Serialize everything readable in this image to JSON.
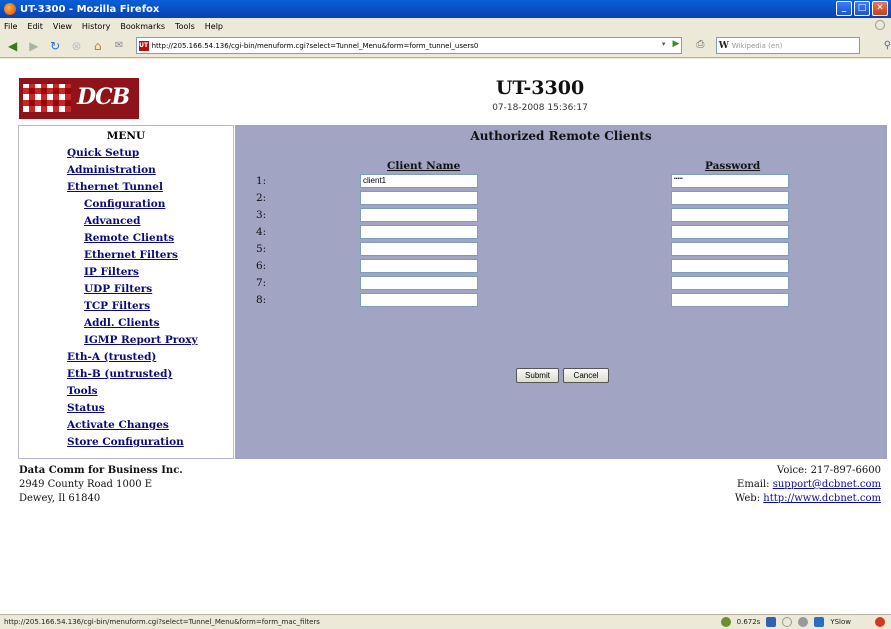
{
  "window": {
    "title": "UT-3300 - Mozilla Firefox"
  },
  "menubar": [
    "File",
    "Edit",
    "View",
    "History",
    "Bookmarks",
    "Tools",
    "Help"
  ],
  "browser": {
    "url": "http://205.166.54.136/cgi-bin/menuform.cgi?select=Tunnel_Menu&form=form_tunnel_users0",
    "search_placeholder": "Wikipedia (en)",
    "search_engine": "W"
  },
  "header": {
    "logo_text": "DCB",
    "device": "UT-3300",
    "datetime": "07-18-2008 15:36:17"
  },
  "menu": {
    "title": "MENU",
    "items": [
      {
        "label": "Quick Setup",
        "level": 1
      },
      {
        "label": "Administration",
        "level": 1
      },
      {
        "label": "Ethernet Tunnel",
        "level": 1
      },
      {
        "label": "Configuration",
        "level": 2
      },
      {
        "label": "Advanced",
        "level": 2
      },
      {
        "label": "Remote Clients",
        "level": 2
      },
      {
        "label": "Ethernet Filters",
        "level": 2
      },
      {
        "label": "IP Filters",
        "level": 2
      },
      {
        "label": "UDP Filters",
        "level": 2
      },
      {
        "label": "TCP Filters",
        "level": 2
      },
      {
        "label": "Addl. Clients",
        "level": 2
      },
      {
        "label": "IGMP Report Proxy",
        "level": 2
      },
      {
        "label": "Eth-A (trusted)",
        "level": 1
      },
      {
        "label": "Eth-B (untrusted)",
        "level": 1
      },
      {
        "label": "Tools",
        "level": 1
      },
      {
        "label": "Status",
        "level": 1
      },
      {
        "label": "Activate Changes",
        "level": 1
      },
      {
        "label": "Store Configuration",
        "level": 1
      }
    ]
  },
  "form": {
    "title": "Authorized Remote Clients",
    "client_header": "Client Name",
    "password_header": "Password",
    "rows": [
      {
        "num": "1:",
        "client": "client1",
        "password": "•••••"
      },
      {
        "num": "2:",
        "client": "",
        "password": ""
      },
      {
        "num": "3:",
        "client": "",
        "password": ""
      },
      {
        "num": "4:",
        "client": "",
        "password": ""
      },
      {
        "num": "5:",
        "client": "",
        "password": ""
      },
      {
        "num": "6:",
        "client": "",
        "password": ""
      },
      {
        "num": "7:",
        "client": "",
        "password": ""
      },
      {
        "num": "8:",
        "client": "",
        "password": ""
      }
    ],
    "submit": "Submit",
    "cancel": "Cancel"
  },
  "footer": {
    "company": "Data Comm for Business Inc.",
    "address1": "2949 County Road 1000 E",
    "address2": "Dewey, Il 61840",
    "voice": "Voice: 217-897-6600",
    "email_label": "Email:",
    "email": "support@dcbnet.com",
    "web_label": "Web:",
    "web": "http://www.dcbnet.com"
  },
  "statusbar": {
    "text": "http://205.166.54.136/cgi-bin/menuform.cgi?select=Tunnel_Menu&form=form_mac_filters",
    "timing": "0.672s",
    "yslow": "YSlow"
  }
}
